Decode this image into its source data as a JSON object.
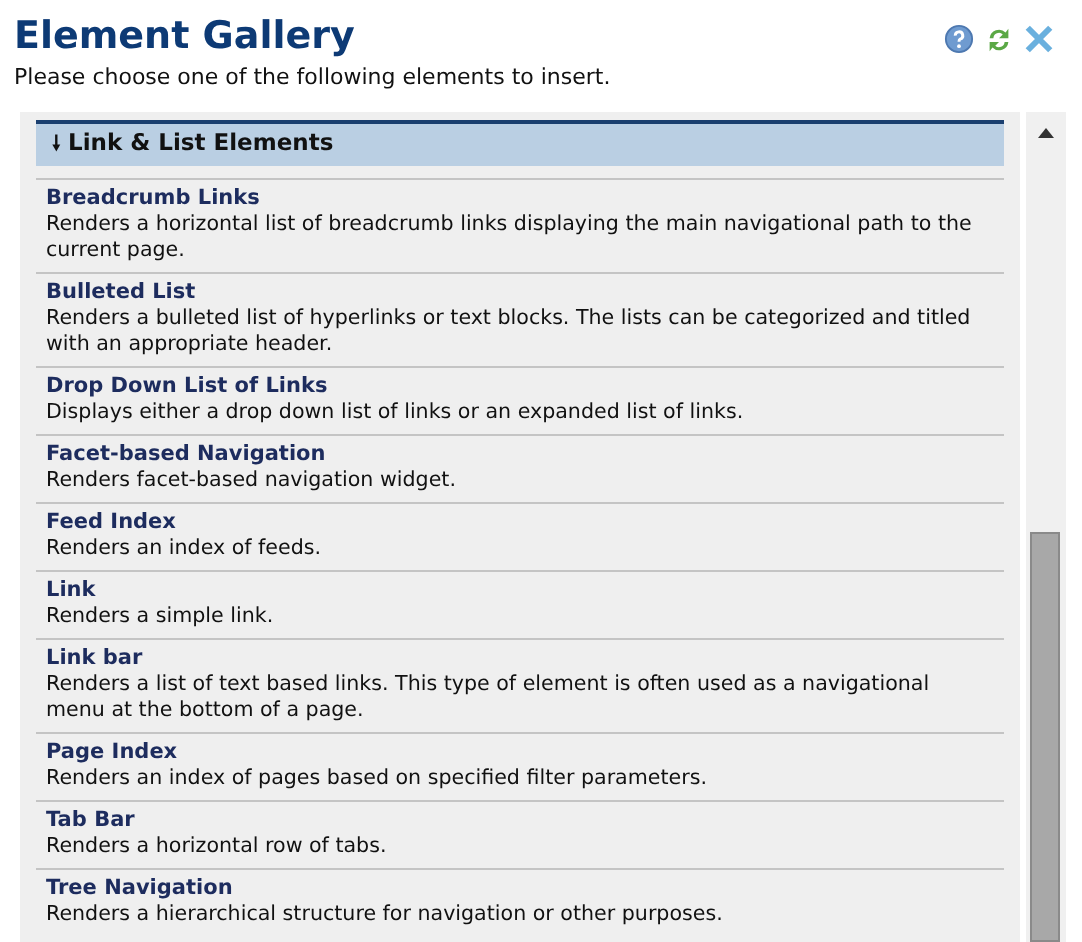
{
  "title": "Element Gallery",
  "subtitle": "Please choose one of the following elements to insert.",
  "section": {
    "arrow": "🠗",
    "label": "Link & List Elements",
    "expanded": true
  },
  "items": [
    {
      "name": "Breadcrumb Links",
      "description": "Renders a horizontal list of breadcrumb links displaying the main navigational path to the current page."
    },
    {
      "name": "Bulleted List",
      "description": "Renders a bulleted list of hyperlinks or text blocks. The lists can be categorized and titled with an appropriate header."
    },
    {
      "name": "Drop Down List of Links",
      "description": "Displays either a drop down list of links or an expanded list of links."
    },
    {
      "name": "Facet-based Navigation",
      "description": "Renders facet-based navigation widget."
    },
    {
      "name": "Feed Index",
      "description": "Renders an index of feeds."
    },
    {
      "name": "Link",
      "description": "Renders a simple link."
    },
    {
      "name": "Link bar",
      "description": "Renders a list of text based links. This type of element is often used as a navigational menu at the bottom of a page."
    },
    {
      "name": "Page Index",
      "description": "Renders an index of pages based on specified filter parameters."
    },
    {
      "name": "Tab Bar",
      "description": "Renders a horizontal row of tabs."
    },
    {
      "name": "Tree Navigation",
      "description": "Renders a hierarchical structure for navigation or other purposes."
    }
  ]
}
